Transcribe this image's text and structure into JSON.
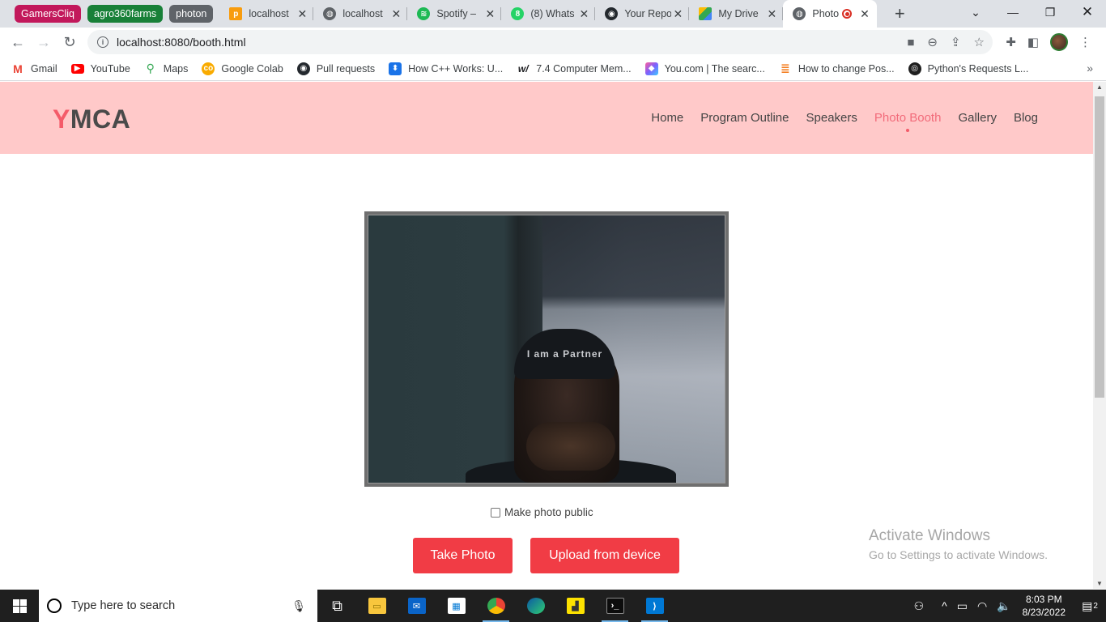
{
  "browser": {
    "tab_groups": [
      {
        "label": "GamersCliq",
        "color": "#c2185b"
      },
      {
        "label": "agro360farms",
        "color": "#188038"
      },
      {
        "label": "photon",
        "color": "#5f6368"
      }
    ],
    "tabs": [
      {
        "title": "localhost",
        "icon": "phpmyadmin-icon"
      },
      {
        "title": "localhost",
        "icon": "globe-icon"
      },
      {
        "title": "Spotify – ",
        "icon": "spotify-icon"
      },
      {
        "title": "(8) Whats",
        "icon": "whatsapp-icon"
      },
      {
        "title": "Your Repo",
        "icon": "github-icon"
      },
      {
        "title": "My Drive",
        "icon": "google-drive-icon"
      },
      {
        "title": "Photo",
        "icon": "globe-icon",
        "active": true,
        "recording": true
      }
    ],
    "url": "localhost:8080/booth.html",
    "bookmarks": [
      {
        "label": "Gmail",
        "icon": "gmail-icon",
        "color": "#ea4335"
      },
      {
        "label": "YouTube",
        "icon": "youtube-icon",
        "color": "#ff0000"
      },
      {
        "label": "Maps",
        "icon": "maps-icon",
        "color": "#34a853"
      },
      {
        "label": "Google Colab",
        "icon": "colab-icon",
        "color": "#f9ab00"
      },
      {
        "label": "Pull requests",
        "icon": "github-icon",
        "color": "#24292e"
      },
      {
        "label": "How C++ Works: U...",
        "icon": "bookmark-icon",
        "color": "#1a73e8"
      },
      {
        "label": "7.4 Computer Mem...",
        "icon": "wikibooks-icon",
        "color": "#202124"
      },
      {
        "label": "You.com | The searc...",
        "icon": "youcom-icon",
        "color": "#7b61ff"
      },
      {
        "label": "How to change Pos...",
        "icon": "stackoverflow-icon",
        "color": "#f48024"
      },
      {
        "label": "Python's Requests L...",
        "icon": "realpython-icon",
        "color": "#1f1f1f"
      }
    ]
  },
  "site": {
    "logo_first": "Y",
    "logo_rest": "MCA",
    "nav": [
      {
        "label": "Home"
      },
      {
        "label": "Program Outline"
      },
      {
        "label": "Speakers"
      },
      {
        "label": "Photo Booth",
        "active": true
      },
      {
        "label": "Gallery"
      },
      {
        "label": "Blog"
      }
    ],
    "camera_cap_text": "I am a Partner",
    "public_checkbox_label": "Make photo public",
    "public_checked": false,
    "take_photo_label": "Take Photo",
    "upload_label": "Upload from device",
    "accent_color": "#f13c45",
    "nav_bg_color": "#ffc9c9"
  },
  "watermark": {
    "line1": "Activate Windows",
    "line2": "Go to Settings to activate Windows."
  },
  "taskbar": {
    "search_placeholder": "Type here to search",
    "time": "8:03 PM",
    "date": "8/23/2022",
    "notifications": "2"
  }
}
